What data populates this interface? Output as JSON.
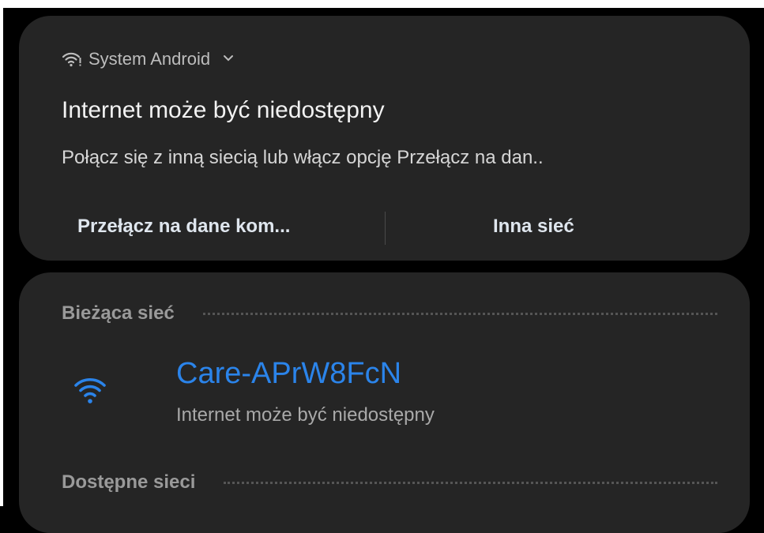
{
  "notification": {
    "app_name": "System Android",
    "app_icon": "wifi-warning-icon",
    "expand_icon": "chevron-down-icon",
    "title": "Internet może być niedostępny",
    "body": "Połącz się z inną siecią lub włącz opcję Przełącz na dan..",
    "actions": [
      {
        "label": "Przełącz na dane kom..."
      },
      {
        "label": "Inna sieć"
      }
    ]
  },
  "wifi": {
    "current_section_label": "Bieżąca sieć",
    "current_network": {
      "icon": "wifi-icon",
      "name": "Care-APrW8FcN",
      "status": "Internet może być niedostępny"
    },
    "available_section_label": "Dostępne sieci"
  },
  "colors": {
    "background": "#000000",
    "card": "#252525",
    "accent": "#2b84ea"
  }
}
